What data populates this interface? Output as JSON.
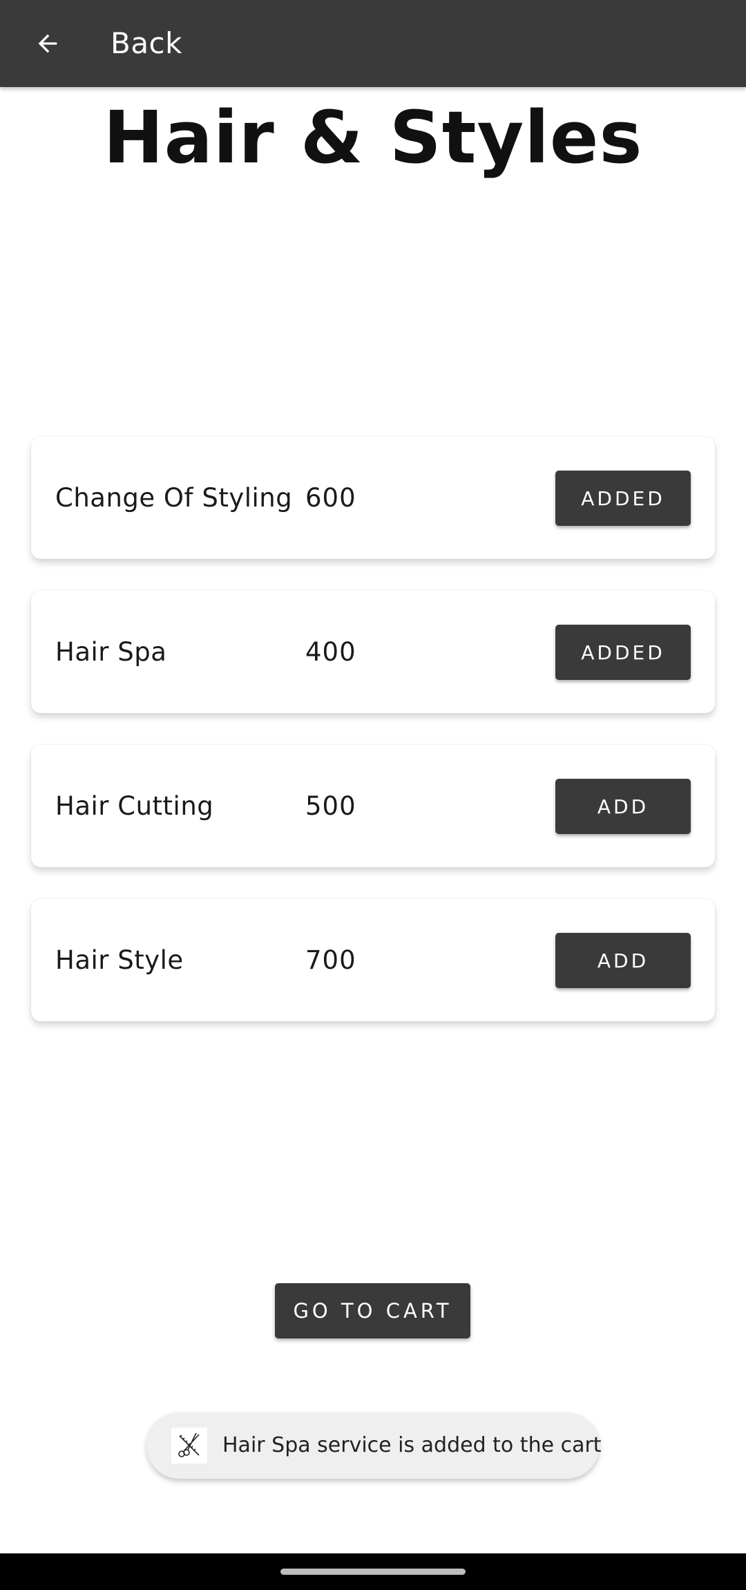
{
  "appbar": {
    "back_label": "Back",
    "back_icon": "arrow-left-icon"
  },
  "page": {
    "title": "Hair & Styles"
  },
  "services": [
    {
      "name": "Change Of Styling",
      "price": "600",
      "button": "ADDED"
    },
    {
      "name": "Hair Spa",
      "price": "400",
      "button": "ADDED"
    },
    {
      "name": "Hair Cutting",
      "price": "500",
      "button": "ADD"
    },
    {
      "name": "Hair Style",
      "price": "700",
      "button": "ADD"
    }
  ],
  "cart": {
    "button_label": "GO TO CART"
  },
  "toast": {
    "icon": "scissors-comb-icon",
    "message": "Hair Spa service is added to the cart"
  },
  "colors": {
    "appbar": "#3a3a3a",
    "button": "#3a3a3a",
    "toast_bg": "#efefef"
  }
}
